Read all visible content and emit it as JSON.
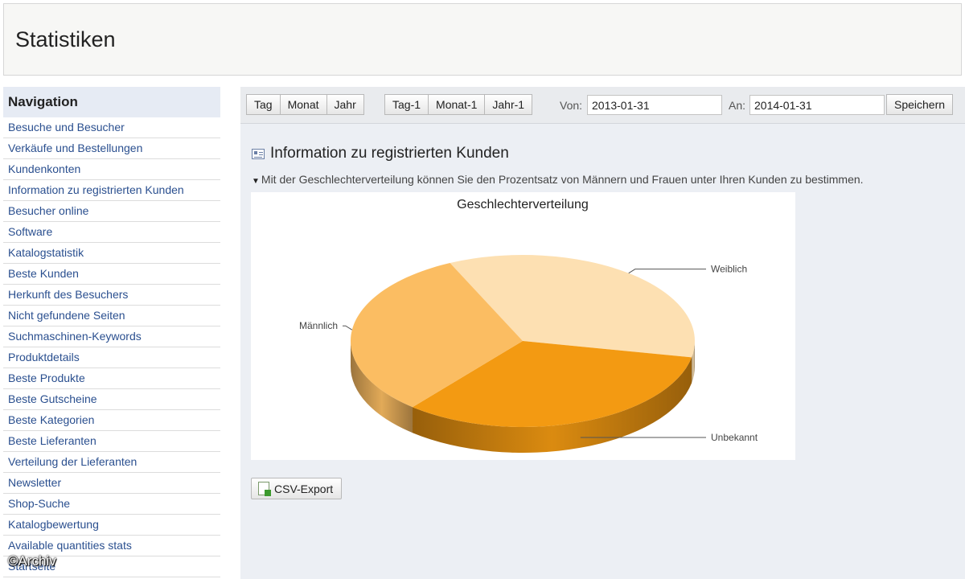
{
  "header": {
    "title": "Statistiken"
  },
  "sidebar": {
    "title": "Navigation",
    "items": [
      "Besuche und Besucher",
      "Verkäufe und Bestellungen",
      "Kundenkonten",
      "Information zu registrierten Kunden",
      "Besucher online",
      "Software",
      "Katalogstatistik",
      "Beste Kunden",
      "Herkunft des Besuchers",
      "Nicht gefundene Seiten",
      "Suchmaschinen-Keywords",
      "Produktdetails",
      "Beste Produkte",
      "Beste Gutscheine",
      "Beste Kategorien",
      "Beste Lieferanten",
      "Verteilung der Lieferanten",
      "Newsletter",
      "Shop-Suche",
      "Katalogbewertung",
      "Available quantities stats",
      "Startseite"
    ]
  },
  "watermark": "©Archiv",
  "toolbar": {
    "group1": [
      "Tag",
      "Monat",
      "Jahr"
    ],
    "group2": [
      "Tag-1",
      "Monat-1",
      "Jahr-1"
    ],
    "from_label": "Von:",
    "from_value": "2013-01-31",
    "to_label": "An:",
    "to_value": "2014-01-31",
    "save_label": "Speichern"
  },
  "panel": {
    "title": "Information zu registrierten Kunden",
    "description": "Mit der Geschlechterverteilung können Sie den Prozentsatz von Männern und Frauen unter Ihren Kunden zu bestimmen.",
    "csv_label": "CSV-Export",
    "icons": {
      "panel": "list-icon",
      "toggle": "triangle-down-icon",
      "csv": "excel-file-icon"
    }
  },
  "chart_data": {
    "type": "pie",
    "title": "Geschlechterverteilung",
    "labels": [
      "Weiblich",
      "Unbekannt",
      "Männlich"
    ],
    "values": [
      35,
      33,
      32
    ],
    "colors": [
      "#fde0b2",
      "#f39a12",
      "#fbbd62"
    ],
    "pie_3d": true
  }
}
